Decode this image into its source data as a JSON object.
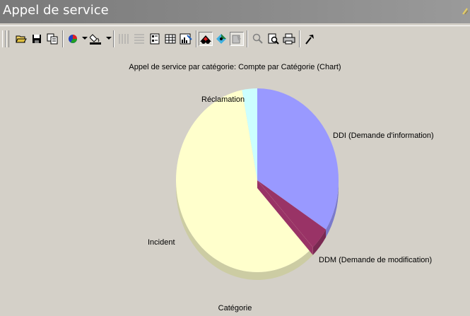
{
  "window": {
    "title": "Appel de service"
  },
  "toolbar": {
    "buttons": [
      {
        "icon": "open-folder-icon"
      },
      {
        "icon": "save-icon"
      },
      {
        "icon": "copy-icon"
      },
      {
        "icon": "chart-type-icon"
      },
      {
        "icon": "fill-color-icon"
      },
      {
        "icon": "vertical-gridlines-icon"
      },
      {
        "icon": "horizontal-gridlines-icon"
      },
      {
        "icon": "legend-icon"
      },
      {
        "icon": "data-table-icon"
      },
      {
        "icon": "chart-wizard-icon"
      },
      {
        "icon": "3d-view-icon"
      },
      {
        "icon": "rotate-icon"
      },
      {
        "icon": "format-icon"
      },
      {
        "icon": "zoom-icon"
      },
      {
        "icon": "print-preview-icon"
      },
      {
        "icon": "print-icon"
      },
      {
        "icon": "tools-icon"
      }
    ]
  },
  "chart_data": {
    "type": "pie",
    "title": "Appel de service par catégorie: Compte par Catégorie (Chart)",
    "xlabel": "Catégorie",
    "categories": [
      "DDI (Demande d'information)",
      "DDM (Demande de modification)",
      "Incident",
      "Réclamation"
    ],
    "values": [
      34,
      4,
      59,
      3
    ],
    "colors": [
      "#9999ff",
      "#993366",
      "#ffffcc",
      "#ccffff"
    ],
    "three_d": true,
    "legend": "none"
  }
}
